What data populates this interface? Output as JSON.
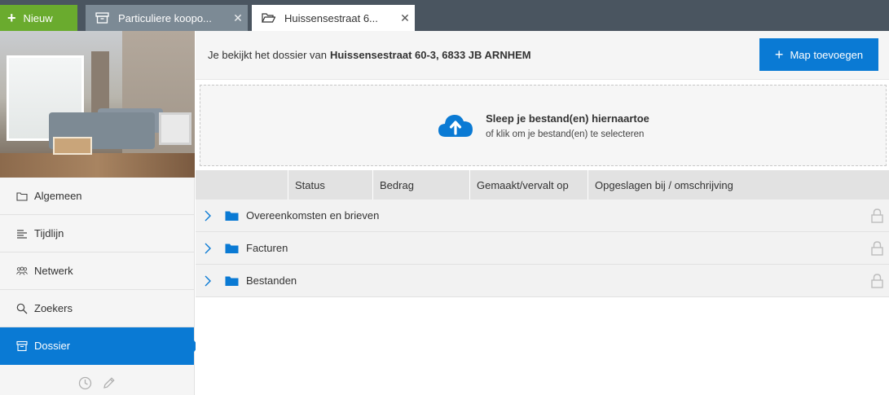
{
  "topbar": {
    "new_label": "Nieuw",
    "tabs": [
      {
        "label": "Particuliere koopo...",
        "icon": "archive-box-icon",
        "active": false
      },
      {
        "label": "Huissensestraat 6...",
        "icon": "folder-open-icon",
        "active": true
      }
    ]
  },
  "sidebar": {
    "items": [
      {
        "label": "Algemeen",
        "icon": "folder-icon"
      },
      {
        "label": "Tijdlijn",
        "icon": "timeline-list-icon"
      },
      {
        "label": "Netwerk",
        "icon": "people-icon"
      },
      {
        "label": "Zoekers",
        "icon": "search-icon"
      },
      {
        "label": "Dossier",
        "icon": "archive-box-icon",
        "active": true
      }
    ],
    "footer_icons": [
      "clock-icon",
      "pencil-icon"
    ]
  },
  "header": {
    "intro": "Je bekijkt het dossier van",
    "address": "Huissensestraat 60-3, 6833 JB ARNHEM",
    "add_folder_label": "Map toevoegen"
  },
  "dropzone": {
    "title": "Sleep je bestand(en) hiernaartoe",
    "subtitle": "of klik om je bestand(en) te selecteren"
  },
  "table": {
    "columns": [
      "",
      "Status",
      "Bedrag",
      "Gemaakt/vervalt op",
      "Opgeslagen bij / omschrijving"
    ],
    "rows": [
      {
        "name": "Overeenkomsten en brieven"
      },
      {
        "name": "Facturen"
      },
      {
        "name": "Bestanden"
      }
    ]
  },
  "colors": {
    "accent": "#0a7ad4",
    "new_button": "#6aab2e",
    "topbar": "#4a5560",
    "inactive_tab": "#7c8a95"
  }
}
